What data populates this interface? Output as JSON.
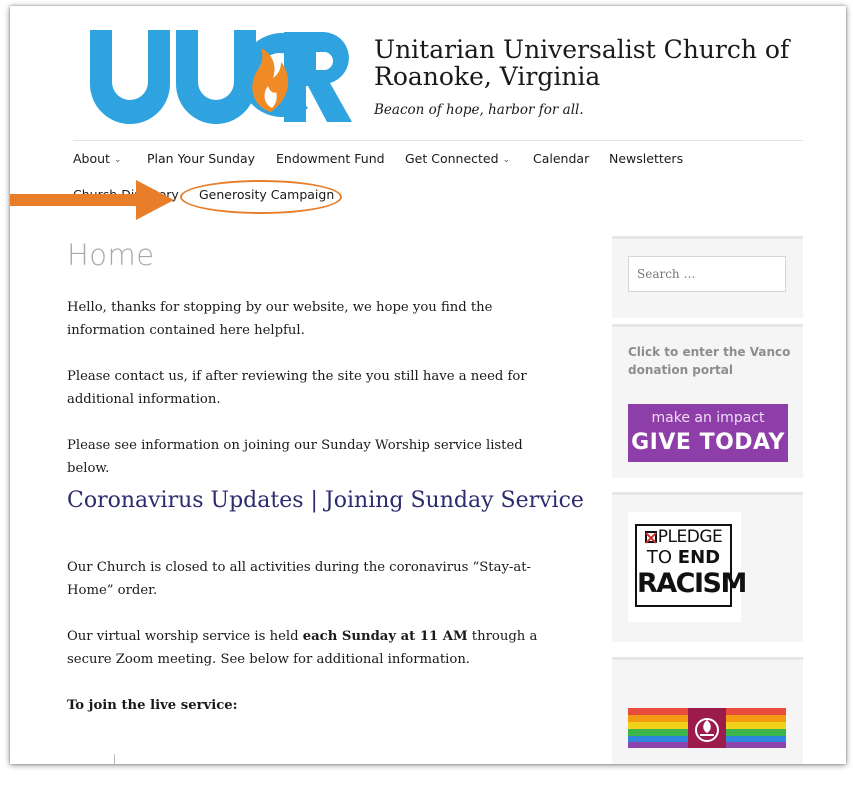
{
  "header": {
    "logo_text": "UUCR",
    "site_title": "Unitarian Universalist Church of Roanoke, Virginia",
    "tagline": "Beacon of hope, harbor for all."
  },
  "nav": {
    "items": [
      {
        "label": "About",
        "has_dropdown": true
      },
      {
        "label": "Plan Your Sunday",
        "has_dropdown": false
      },
      {
        "label": "Endowment Fund",
        "has_dropdown": false
      },
      {
        "label": "Get Connected",
        "has_dropdown": true
      },
      {
        "label": "Calendar",
        "has_dropdown": false
      },
      {
        "label": "Newsletters",
        "has_dropdown": false
      },
      {
        "label": "Church Directory",
        "has_dropdown": false
      },
      {
        "label": "Generosity Campaign",
        "has_dropdown": false
      }
    ],
    "highlighted": "Generosity Campaign",
    "annotation_color": "#e87e2a"
  },
  "main": {
    "page_title": "Home",
    "paragraphs": [
      "Hello, thanks for stopping by our website, we hope you find the information contained here helpful.",
      "Please contact us, if after reviewing the site you still have a need for additional information.",
      "Please see information on joining our Sunday Worship service listed below."
    ],
    "section_title": "Coronavirus Updates | Joining Sunday Service",
    "section_paragraphs": [
      "Our Church is closed to all activities during the coronavirus “Stay-at-Home” order.",
      {
        "before": "Our virtual worship service is held ",
        "bold": "each Sunday at 11 AM",
        "after": " through a secure Zoom meeting. See below for additional information."
      }
    ],
    "join_heading": "To join the live service:"
  },
  "sidebar": {
    "search_placeholder": "Search …",
    "vanco_link": "Click to enter the Vanco donation portal",
    "give_banner": {
      "small": "make an impact",
      "big": "GIVE TODAY",
      "color": "#8e3ea8"
    },
    "pledge_image": {
      "line1": "PLEDGE",
      "line2a": "TO ",
      "line2b": "END",
      "line3": "RACISM"
    },
    "rainbow_icon": "uu-chalice-rainbow-icon"
  },
  "colors": {
    "logo_blue": "#2ea3e0",
    "flame_orange": "#f08a24",
    "heading_purple": "#2b2b6e",
    "title_gray": "#a8a8a8"
  }
}
